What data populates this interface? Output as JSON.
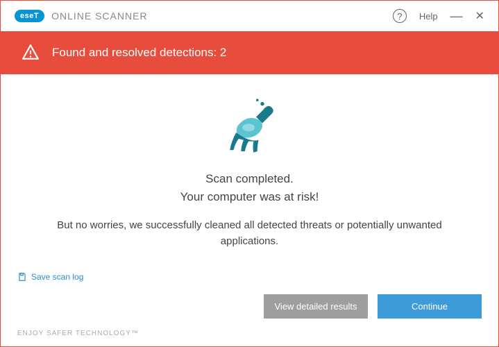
{
  "header": {
    "logo_text": "eseT",
    "app_title": "ONLINE SCANNER",
    "help_label": "Help"
  },
  "banner": {
    "message": "Found and resolved detections: 2"
  },
  "content": {
    "headline_line1": "Scan completed.",
    "headline_line2": "Your computer was at risk!",
    "subtext": "But no worries, we successfully cleaned all detected threats or potentially unwanted applications."
  },
  "actions": {
    "save_log": "Save scan log",
    "view_results": "View detailed results",
    "continue": "Continue"
  },
  "footer": {
    "tagline": "ENJOY SAFER TECHNOLOGY™"
  }
}
